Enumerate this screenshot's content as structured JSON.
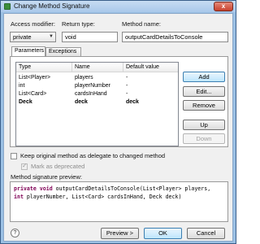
{
  "window": {
    "title": "Change Method Signature",
    "close_label": "x"
  },
  "form": {
    "access_modifier_label": "Access modifier:",
    "access_modifier_value": "private",
    "return_type_label": "Return type:",
    "return_type_value": "void",
    "method_name_label": "Method name:",
    "method_name_value": "outputCardDetailsToConsole"
  },
  "tabs": [
    {
      "label": "Parameters"
    },
    {
      "label": "Exceptions"
    }
  ],
  "table": {
    "columns": [
      "Type",
      "Name",
      "Default value"
    ],
    "rows": [
      {
        "type": "List<Player>",
        "name": "players",
        "default": "-"
      },
      {
        "type": "int",
        "name": "playerNumber",
        "default": "-"
      },
      {
        "type": "List<Card>",
        "name": "cardsInHand",
        "default": "-"
      },
      {
        "type": "Deck",
        "name": "deck",
        "default": "deck"
      }
    ]
  },
  "side_buttons": {
    "add": "Add",
    "edit": "Edit...",
    "remove": "Remove",
    "up": "Up",
    "down": "Down"
  },
  "options": {
    "keep_original": "Keep original method as delegate to changed method",
    "mark_deprecated": "Mark as deprecated"
  },
  "preview": {
    "label": "Method signature preview:",
    "kw1": "private",
    "kw2": "void",
    "line1_rest": " outputCardDetailsToConsole(List<Player> players,",
    "kw3": "int",
    "line2_rest": " playerNumber, List<Card> cardsInHand, Deck deck)"
  },
  "footer": {
    "help_label": "?",
    "preview_button": "Preview >",
    "ok_button": "OK",
    "cancel_button": "Cancel"
  }
}
